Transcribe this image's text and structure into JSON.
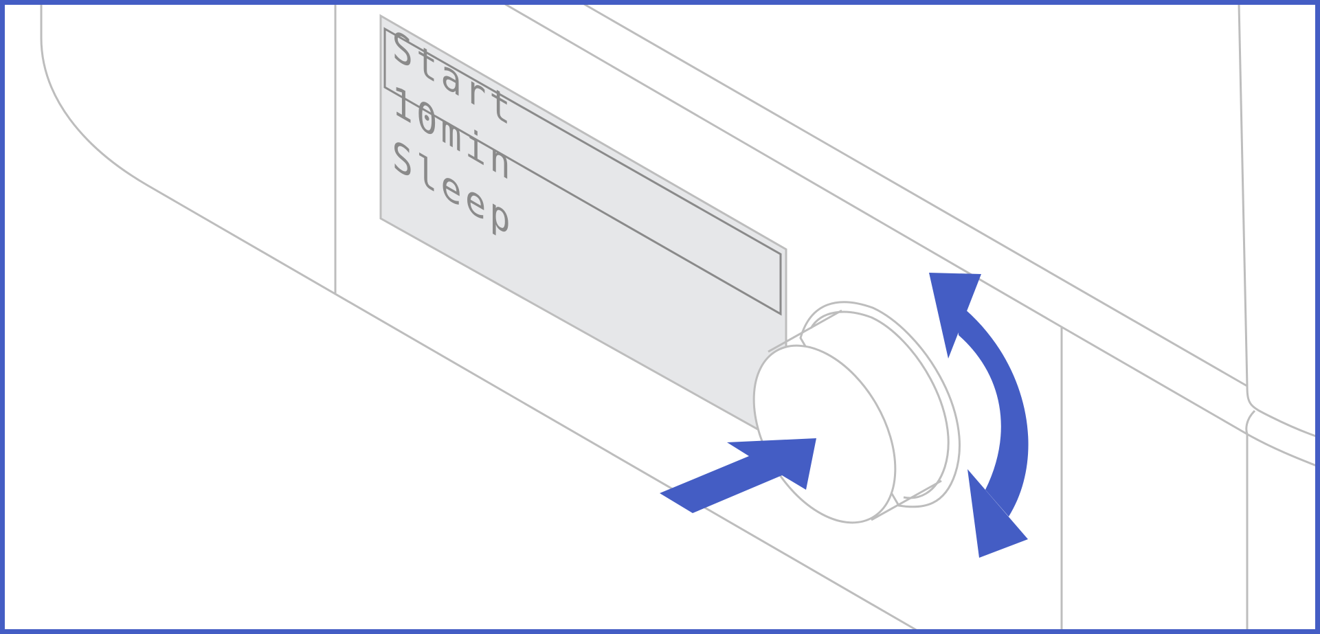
{
  "display": {
    "lines": [
      "Start",
      "10min",
      "Sleep"
    ]
  },
  "colors": {
    "frame": "#445dc4",
    "arrow": "#445dc4",
    "outline": "#bdbdbd",
    "panel_fill": "#e6e7e9",
    "panel_stroke": "#8a8a8a",
    "lcd_text": "#8a8a8a",
    "background": "#ffffff"
  },
  "icons": {
    "press": "press-arrow-icon",
    "rotate": "rotate-arrows-icon"
  }
}
